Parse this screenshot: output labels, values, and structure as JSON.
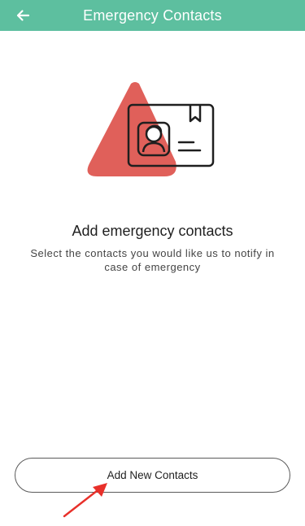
{
  "header": {
    "title": "Emergency Contacts",
    "back_icon": "arrow-left-icon",
    "background_color": "#5dbf9f"
  },
  "illustration": {
    "icon": "contact-card-icon",
    "accent_color": "#e0605a"
  },
  "content": {
    "heading": "Add emergency contacts",
    "description": "Select the contacts you would like us to notify in case of emergency"
  },
  "actions": {
    "add_button_label": "Add New Contacts"
  },
  "annotation": {
    "icon": "red-arrow-icon",
    "color": "#e8302a"
  }
}
